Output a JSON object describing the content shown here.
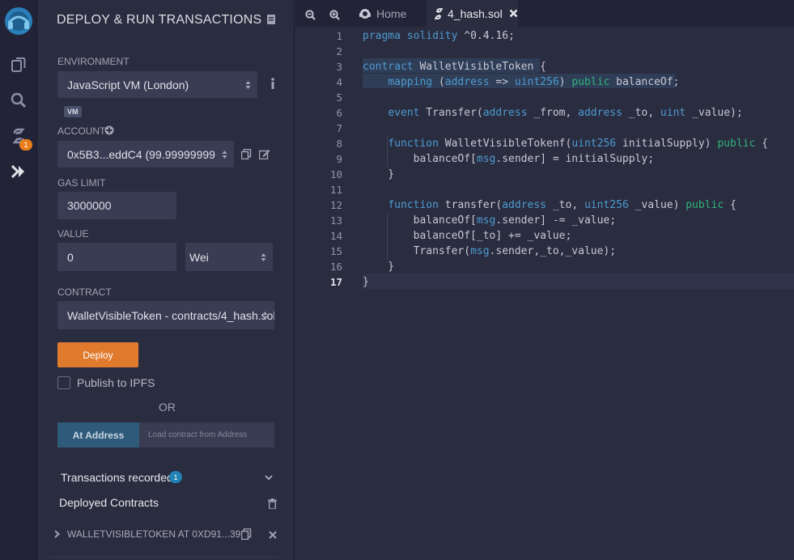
{
  "iconbar": {
    "items": [
      {
        "icon": "remix-logo-icon"
      },
      {
        "icon": "file-explorer-icon"
      },
      {
        "icon": "search-icon"
      },
      {
        "icon": "solidity-compiler-icon",
        "badge": "1"
      },
      {
        "icon": "deploy-run-icon"
      }
    ]
  },
  "panel": {
    "title": "DEPLOY & RUN TRANSACTIONS",
    "environment_label": "ENVIRONMENT",
    "environment_value": "JavaScript VM (London)",
    "vm_badge": "VM",
    "account_label": "ACCOUNT",
    "account_value": "0x5B3...eddC4 (99.99999999",
    "gas_limit_label": "GAS LIMIT",
    "gas_limit_value": "3000000",
    "value_label": "VALUE",
    "value_amount": "0",
    "value_unit": "Wei",
    "contract_label": "CONTRACT",
    "contract_value": "WalletVisibleToken - contracts/4_hash.sol",
    "deploy_label": "Deploy",
    "publish_label": "Publish to IPFS",
    "or_label": "OR",
    "at_address_label": "At Address",
    "load_contract_placeholder": "Load contract from Address",
    "transactions_label": "Transactions recorded",
    "transactions_count": "1",
    "deployed_label": "Deployed Contracts",
    "instance_label": "WALLETVISIBLETOKEN AT 0XD91...391"
  },
  "editor": {
    "tabs": [
      {
        "label": "Home",
        "active": false
      },
      {
        "label": "4_hash.sol",
        "active": true
      }
    ],
    "current_line": "17",
    "lines": [
      {
        "n": "1",
        "code": "pragma solidity ^0.4.16;"
      },
      {
        "n": "2",
        "code": ""
      },
      {
        "n": "3",
        "code": "contract WalletVisibleToken {"
      },
      {
        "n": "4",
        "code": "    mapping (address => uint256) public balanceOf;"
      },
      {
        "n": "5",
        "code": ""
      },
      {
        "n": "6",
        "code": "    event Transfer(address _from, address _to, uint _value);"
      },
      {
        "n": "7",
        "code": ""
      },
      {
        "n": "8",
        "code": "    function WalletVisibleTokenf(uint256 initialSupply) public {"
      },
      {
        "n": "9",
        "code": "        balanceOf[msg.sender] = initialSupply;"
      },
      {
        "n": "10",
        "code": "    }"
      },
      {
        "n": "11",
        "code": ""
      },
      {
        "n": "12",
        "code": "    function transfer(address _to, uint256 _value) public {"
      },
      {
        "n": "13",
        "code": "        balanceOf[msg.sender] -= _value;"
      },
      {
        "n": "14",
        "code": "        balanceOf[_to] += _value;"
      },
      {
        "n": "15",
        "code": "        Transfer(msg.sender,_to,_value);"
      },
      {
        "n": "16",
        "code": "    }"
      },
      {
        "n": "17",
        "code": "}"
      }
    ]
  }
}
